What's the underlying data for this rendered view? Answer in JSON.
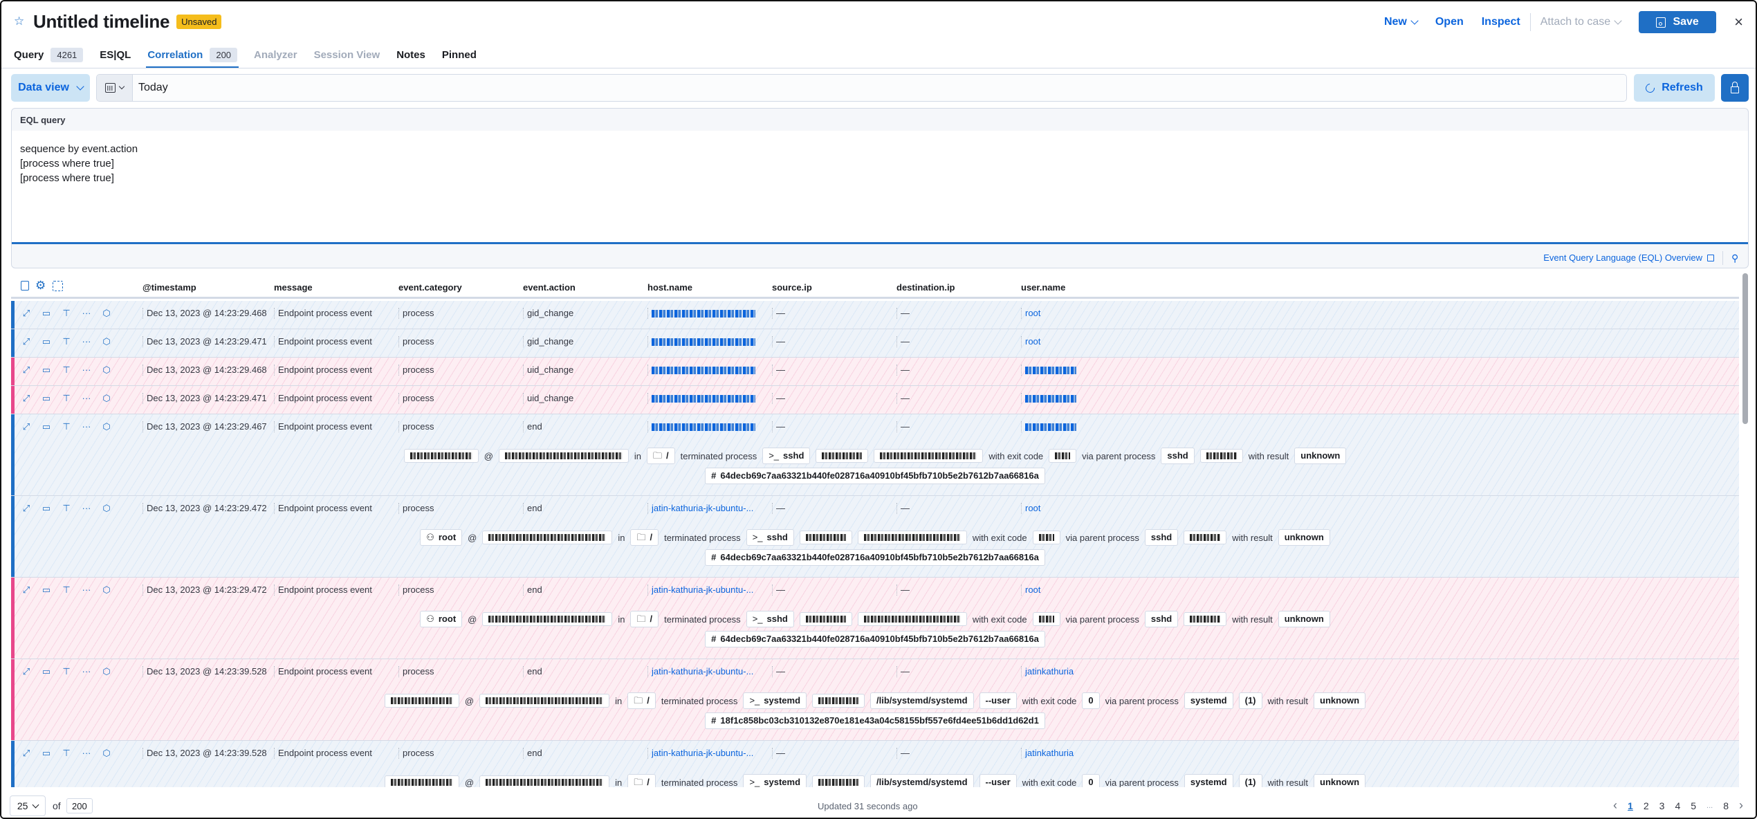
{
  "header": {
    "title": "Untitled timeline",
    "status_badge": "Unsaved",
    "actions": {
      "new": "New",
      "open": "Open",
      "inspect": "Inspect",
      "attach_to_case": "Attach to case",
      "save": "Save"
    }
  },
  "tabs": [
    {
      "label": "Query",
      "count": "4261",
      "state": "normal"
    },
    {
      "label": "ES|QL",
      "count": null,
      "state": "normal"
    },
    {
      "label": "Correlation",
      "count": "200",
      "state": "active"
    },
    {
      "label": "Analyzer",
      "count": null,
      "state": "disabled"
    },
    {
      "label": "Session View",
      "count": null,
      "state": "disabled"
    },
    {
      "label": "Notes",
      "count": null,
      "state": "normal"
    },
    {
      "label": "Pinned",
      "count": null,
      "state": "normal"
    }
  ],
  "filters": {
    "data_view_label": "Data view",
    "date_value": "Today",
    "refresh_label": "Refresh"
  },
  "eql": {
    "label": "EQL query",
    "query": "sequence by event.action\n[process where true]\n[process where true]",
    "overview_link": "Event Query Language (EQL) Overview"
  },
  "table": {
    "columns": [
      "@timestamp",
      "message",
      "event.category",
      "event.action",
      "host.name",
      "source.ip",
      "destination.ip",
      "user.name"
    ],
    "rows": [
      {
        "seq": "blue",
        "timestamp": "Dec 13, 2023 @ 14:23:29.468",
        "message": "Endpoint process event",
        "category": "process",
        "action": "gid_change",
        "host": "",
        "source_ip": "—",
        "dest_ip": "—",
        "user": "root"
      },
      {
        "seq": "blue",
        "timestamp": "Dec 13, 2023 @ 14:23:29.471",
        "message": "Endpoint process event",
        "category": "process",
        "action": "gid_change",
        "host": "",
        "source_ip": "—",
        "dest_ip": "—",
        "user": "root"
      },
      {
        "seq": "pink",
        "timestamp": "Dec 13, 2023 @ 14:23:29.468",
        "message": "Endpoint process event",
        "category": "process",
        "action": "uid_change",
        "host": "",
        "source_ip": "—",
        "dest_ip": "—",
        "user": ""
      },
      {
        "seq": "pink",
        "timestamp": "Dec 13, 2023 @ 14:23:29.471",
        "message": "Endpoint process event",
        "category": "process",
        "action": "uid_change",
        "host": "",
        "source_ip": "—",
        "dest_ip": "—",
        "user": ""
      },
      {
        "seq": "blue",
        "timestamp": "Dec 13, 2023 @ 14:23:29.467",
        "message": "Endpoint process event",
        "category": "process",
        "action": "end",
        "host": "",
        "source_ip": "—",
        "dest_ip": "—",
        "user": "",
        "detail": {
          "user": "",
          "host": "",
          "in": "in",
          "dir": "/",
          "verb": "terminated process",
          "process": "sshd",
          "args": "",
          "exit_label": "with exit code",
          "exit_code": "",
          "parent_label": "via parent process",
          "parent": "sshd",
          "parent_pid": "",
          "result_label": "with result",
          "result": "unknown",
          "hash": "64decb69c7aa63321b440fe028716a40910bf45bfb710b5e2b7612b7aa66816a"
        }
      },
      {
        "seq": "blue",
        "timestamp": "Dec 13, 2023 @ 14:23:29.472",
        "message": "Endpoint process event",
        "category": "process",
        "action": "end",
        "host": "jatin-kathuria-jk-ubuntu-...",
        "source_ip": "—",
        "dest_ip": "—",
        "user": "root",
        "detail": {
          "user": "root",
          "host": "",
          "in": "in",
          "dir": "/",
          "verb": "terminated process",
          "process": "sshd",
          "args": "",
          "exit_label": "with exit code",
          "exit_code": "",
          "parent_label": "via parent process",
          "parent": "sshd",
          "parent_pid": "",
          "result_label": "with result",
          "result": "unknown",
          "hash": "64decb69c7aa63321b440fe028716a40910bf45bfb710b5e2b7612b7aa66816a"
        }
      },
      {
        "seq": "pink",
        "timestamp": "Dec 13, 2023 @ 14:23:29.472",
        "message": "Endpoint process event",
        "category": "process",
        "action": "end",
        "host": "jatin-kathuria-jk-ubuntu-...",
        "source_ip": "—",
        "dest_ip": "—",
        "user": "root",
        "detail": {
          "user": "root",
          "host": "",
          "in": "in",
          "dir": "/",
          "verb": "terminated process",
          "process": "sshd",
          "args": "",
          "exit_label": "with exit code",
          "exit_code": "",
          "parent_label": "via parent process",
          "parent": "sshd",
          "parent_pid": "",
          "result_label": "with result",
          "result": "unknown",
          "hash": "64decb69c7aa63321b440fe028716a40910bf45bfb710b5e2b7612b7aa66816a"
        }
      },
      {
        "seq": "pink",
        "timestamp": "Dec 13, 2023 @ 14:23:39.528",
        "message": "Endpoint process event",
        "category": "process",
        "action": "end",
        "host": "jatin-kathuria-jk-ubuntu-...",
        "source_ip": "—",
        "dest_ip": "—",
        "user": "jatinkathuria",
        "detail": {
          "user": "",
          "host": "",
          "in": "in",
          "dir": "/",
          "verb": "terminated process",
          "process": "systemd",
          "args": "/lib/systemd/systemd",
          "args2": "--user",
          "exit_label": "with exit code",
          "exit_code": "0",
          "parent_label": "via parent process",
          "parent": "systemd",
          "parent_pid": "(1)",
          "result_label": "with result",
          "result": "unknown",
          "hash": "18f1c858bc03cb310132e870e181e43a04c58155bf557e6fd4ee51b6dd1d62d1"
        }
      },
      {
        "seq": "blue",
        "timestamp": "Dec 13, 2023 @ 14:23:39.528",
        "message": "Endpoint process event",
        "category": "process",
        "action": "end",
        "host": "jatin-kathuria-jk-ubuntu-...",
        "source_ip": "—",
        "dest_ip": "—",
        "user": "jatinkathuria",
        "detail": {
          "user": "",
          "host": "",
          "in": "in",
          "dir": "/",
          "verb": "terminated process",
          "process": "systemd",
          "args": "/lib/systemd/systemd",
          "args2": "--user",
          "exit_label": "with exit code",
          "exit_code": "0",
          "parent_label": "via parent process",
          "parent": "systemd",
          "parent_pid": "(1)",
          "result_label": "with result",
          "result": "unknown"
        }
      }
    ]
  },
  "footer": {
    "rows_per_page": "25",
    "of_label": "of",
    "total": "200",
    "updated": "Updated 31 seconds ago",
    "pages": [
      "1",
      "2",
      "3",
      "4",
      "5",
      "...",
      "8"
    ],
    "current_page": "1"
  },
  "colors": {
    "accent": "#1f6fc5",
    "unsaved_badge": "#f5bd1c",
    "sequence_a": "#1f6fc5",
    "sequence_b": "#e8478b"
  }
}
